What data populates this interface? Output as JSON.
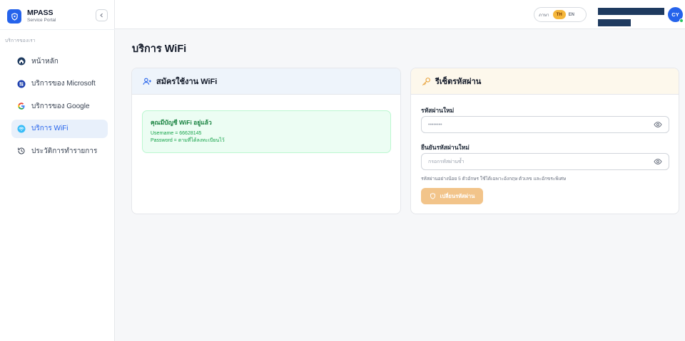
{
  "brand": {
    "title": "MPASS",
    "subtitle": "Service Portal"
  },
  "sidebar": {
    "section_label": "บริการของเรา",
    "items": [
      {
        "label": "หน้าหลัก",
        "icon": "home-icon"
      },
      {
        "label": "บริการของ Microsoft",
        "icon": "microsoft-icon"
      },
      {
        "label": "บริการของ Google",
        "icon": "google-icon"
      },
      {
        "label": "บริการ WiFi",
        "icon": "wifi-icon",
        "active": true
      },
      {
        "label": "ประวัติการทำรายการ",
        "icon": "history-icon"
      }
    ]
  },
  "topbar": {
    "lang_label": "ภาษา",
    "lang_th": "TH",
    "lang_en": "EN",
    "avatar_initials": "CY"
  },
  "page": {
    "title": "บริการ WiFi"
  },
  "wifi_card": {
    "title": "สมัครใช้งาน WiFi",
    "alert_title": "คุณมีบัญชี WiFi อยู่แล้ว",
    "username_line": "Username = 66628145",
    "password_line": "Password = ตามที่ได้ลงทะเบียนไว้"
  },
  "reset_card": {
    "title": "รีเซ็ตรหัสผ่าน",
    "new_password_label": "รหัสผ่านใหม่",
    "new_password_value": "••••••••",
    "confirm_label": "ยืนยันรหัสผ่านใหม่",
    "confirm_placeholder": "กรอกรหัสผ่านซ้ำ",
    "hint": "รหัสผ่านอย่างน้อย 5 ตัวอักษร ใช้ได้เฉพาะอังกฤษ ตัวเลข และอักขระพิเศษ",
    "submit_label": "เปลี่ยนรหัสผ่าน"
  },
  "colors": {
    "accent": "#2563eb",
    "active_bg": "#e8f0fb",
    "success": "#16a34a",
    "warning_btn": "#f2c48a",
    "lang_active": "#f5b73b"
  }
}
